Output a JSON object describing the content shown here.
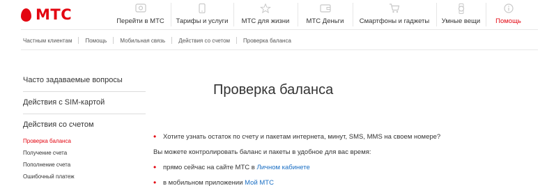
{
  "brand": {
    "logo_text": "МТС",
    "accent": "#e30611",
    "link_color": "#1a6fc4"
  },
  "nav": {
    "items": [
      {
        "label": "Перейти в МТС",
        "icon": "transfer-icon"
      },
      {
        "label": "Тарифы и услуги",
        "icon": "phone-icon"
      },
      {
        "label": "МТС для жизни",
        "icon": "star-icon"
      },
      {
        "label": "МТС Деньги",
        "icon": "wallet-icon"
      },
      {
        "label": "Смартфоны и гаджеты",
        "icon": "cart-icon"
      },
      {
        "label": "Умные вещи",
        "icon": "watch-icon"
      },
      {
        "label": "Помощь",
        "icon": "info-icon"
      }
    ]
  },
  "breadcrumbs": [
    "Частным клиентам",
    "Помощь",
    "Мобильная связь",
    "Действия со счетом",
    "Проверка баланса"
  ],
  "sidebar": {
    "items": [
      "Часто задаваемые вопросы",
      "Действия с SIM-картой",
      "Действия со счетом"
    ],
    "subitems": [
      "Проверка баланса",
      "Получение счета",
      "Пополнение счета",
      "Ошибочный платеж"
    ]
  },
  "main": {
    "title": "Проверка баланса",
    "bullet1": "Хотите узнать остаток по счету и пакетам интернета, минут, SMS, MMS на своем номере?",
    "paragraph": "Вы можете контролировать баланс и пакеты в удобное для вас время:",
    "bullet2_text": "прямо сейчас на сайте МТС в ",
    "bullet2_link": "Личном кабинете",
    "bullet3_text": "в мобильном приложении ",
    "bullet3_link": "Мой МТС"
  }
}
